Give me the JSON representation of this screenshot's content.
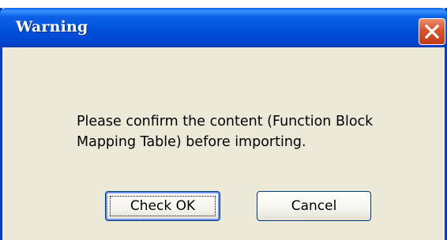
{
  "dialog": {
    "title": "Warning",
    "message_lines": [
      "Please confirm the content (Function Block",
      "Mapping Table) before importing."
    ],
    "buttons": {
      "primary": "Check OK",
      "secondary": "Cancel"
    }
  },
  "colors": {
    "titlebar": "#0052dc",
    "dialog_background": "#ece9d8",
    "close_button": "#d9532d"
  },
  "icons": {
    "close": "close-icon"
  }
}
